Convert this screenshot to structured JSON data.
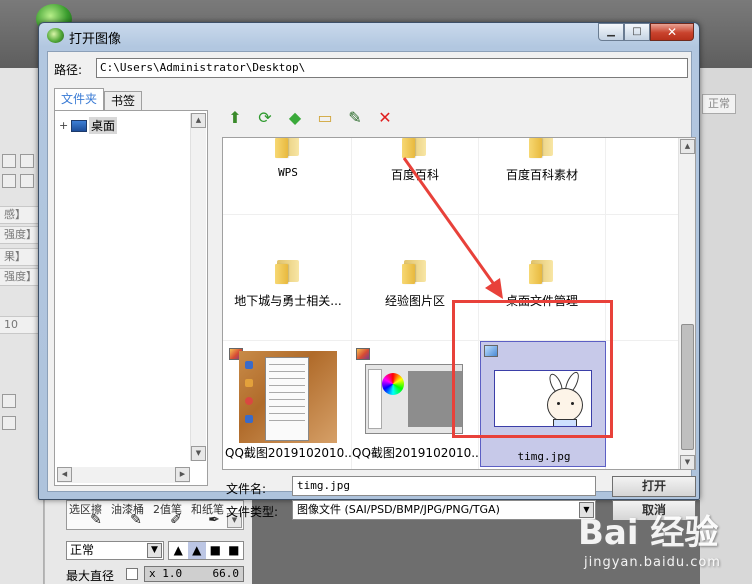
{
  "dialog": {
    "title": "打开图像",
    "window_buttons": {
      "minimize": "▁",
      "maximize": "□",
      "close": "✕"
    },
    "path": {
      "label": "路径:",
      "value": "C:\\Users\\Administrator\\Desktop\\"
    },
    "tabs": [
      {
        "label": "文件夹",
        "active": true
      },
      {
        "label": "书签",
        "active": false
      }
    ],
    "tree": {
      "expand": "+",
      "root_label": "桌面"
    },
    "toolbar": [
      {
        "name": "up-folder-icon",
        "glyph": "⬆",
        "color": "#3a8a2a"
      },
      {
        "name": "refresh-icon",
        "glyph": "⟳",
        "color": "#2f9a2f"
      },
      {
        "name": "bookmark-tag-icon",
        "glyph": "◆",
        "color": "#3aaa3a"
      },
      {
        "name": "new-folder-icon",
        "glyph": "▭",
        "color": "#d1a53a"
      },
      {
        "name": "rename-icon",
        "glyph": "✎",
        "color": "#2a6a2a"
      },
      {
        "name": "delete-icon",
        "glyph": "✕",
        "color": "#e02020"
      }
    ],
    "files": {
      "row1": [
        {
          "label": "WPS"
        },
        {
          "label": "百度百科"
        },
        {
          "label": "百度百科素材"
        }
      ],
      "row2": [
        {
          "label": "地下城与勇士相关..."
        },
        {
          "label": "经验图片区"
        },
        {
          "label": "桌面文件管理"
        }
      ],
      "row3": [
        {
          "label": "QQ截图2019102010..."
        },
        {
          "label": "QQ截图2019102010..."
        },
        {
          "label": "timg.jpg",
          "selected": true
        }
      ]
    },
    "filename": {
      "label": "文件名:",
      "value": "timg.jpg"
    },
    "filetype": {
      "label": "文件类型:",
      "value": "图像文件 (SAI/PSD/BMP/JPG/PNG/TGA)"
    },
    "open_button": "打开",
    "cancel_button": "取消"
  },
  "background": {
    "left_rows": [
      "感】",
      "强度】",
      "果】",
      "强度】",
      "10"
    ],
    "right_button": "正常",
    "tools": [
      "选区擦",
      "油漆桶",
      "2值笔",
      "和纸笔"
    ],
    "blend_mode": "正常",
    "max_diameter": {
      "label": "最大直径",
      "multiplier": "x 1.0",
      "value": "66.0"
    }
  },
  "watermark": {
    "main": "Bai 经验",
    "sub": "jingyan.baidu.com"
  },
  "colors": {
    "accent_red": "#e8413a",
    "selection": "#c7c9e9"
  }
}
